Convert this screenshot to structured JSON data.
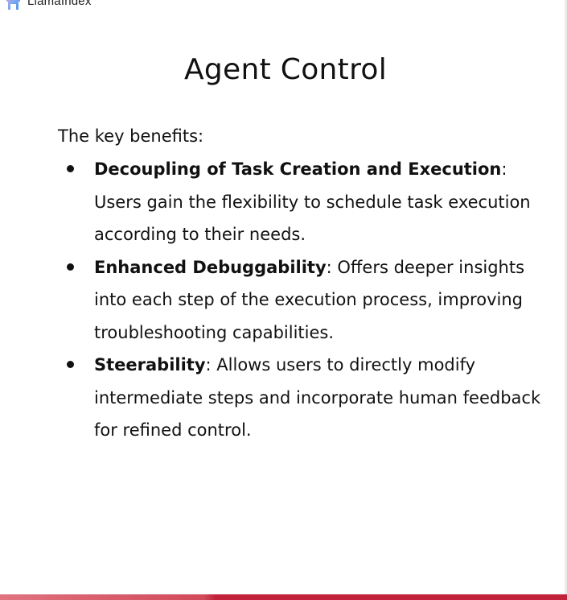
{
  "brand": {
    "logo_text": "LlamaIndex",
    "logo_icon": "llama-icon"
  },
  "slide": {
    "title": "Agent Control",
    "intro": "The key benefits:",
    "benefits": [
      {
        "title": "Decoupling of Task Creation and Execution",
        "text": ": Users gain the flexibility to schedule task execution according to their needs."
      },
      {
        "title": "Enhanced Debuggability",
        "text": ": Offers deeper insights into each step of the execution process, improving troubleshooting capabilities."
      },
      {
        "title": "Steerability",
        "text": ": Allows users to directly modify intermediate steps and incorporate human feedback for refined control."
      }
    ]
  },
  "colors": {
    "text": "#111111",
    "accent_bar": "#c1223a",
    "accent_bar_light": "#e0737f",
    "logo_icon": "#4a8fe7"
  }
}
